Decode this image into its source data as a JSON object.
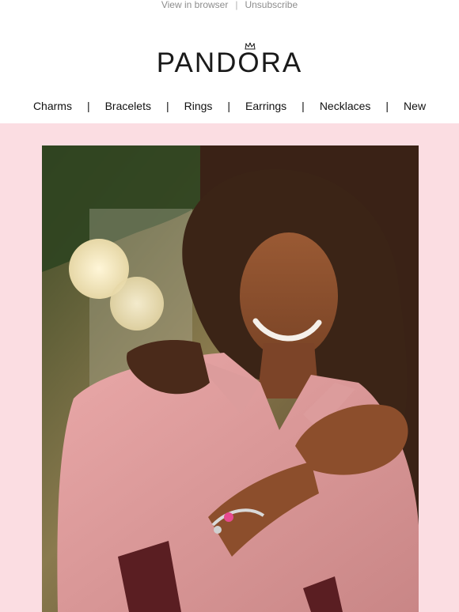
{
  "top_links": {
    "view_in_browser": "View in browser",
    "separator": "|",
    "unsubscribe": "Unsubscribe"
  },
  "brand": {
    "logo_text": "PANDORA",
    "logo_mark": "crown-icon"
  },
  "nav": {
    "items": [
      {
        "label": "Charms"
      },
      {
        "label": "Bracelets"
      },
      {
        "label": "Rings"
      },
      {
        "label": "Earrings"
      },
      {
        "label": "Necklaces"
      },
      {
        "label": "New"
      }
    ],
    "separator": "|"
  },
  "hero": {
    "image_semantic": "hero-photo-woman-pink-shirt-bracelet",
    "background_color": "#fbdde2"
  }
}
